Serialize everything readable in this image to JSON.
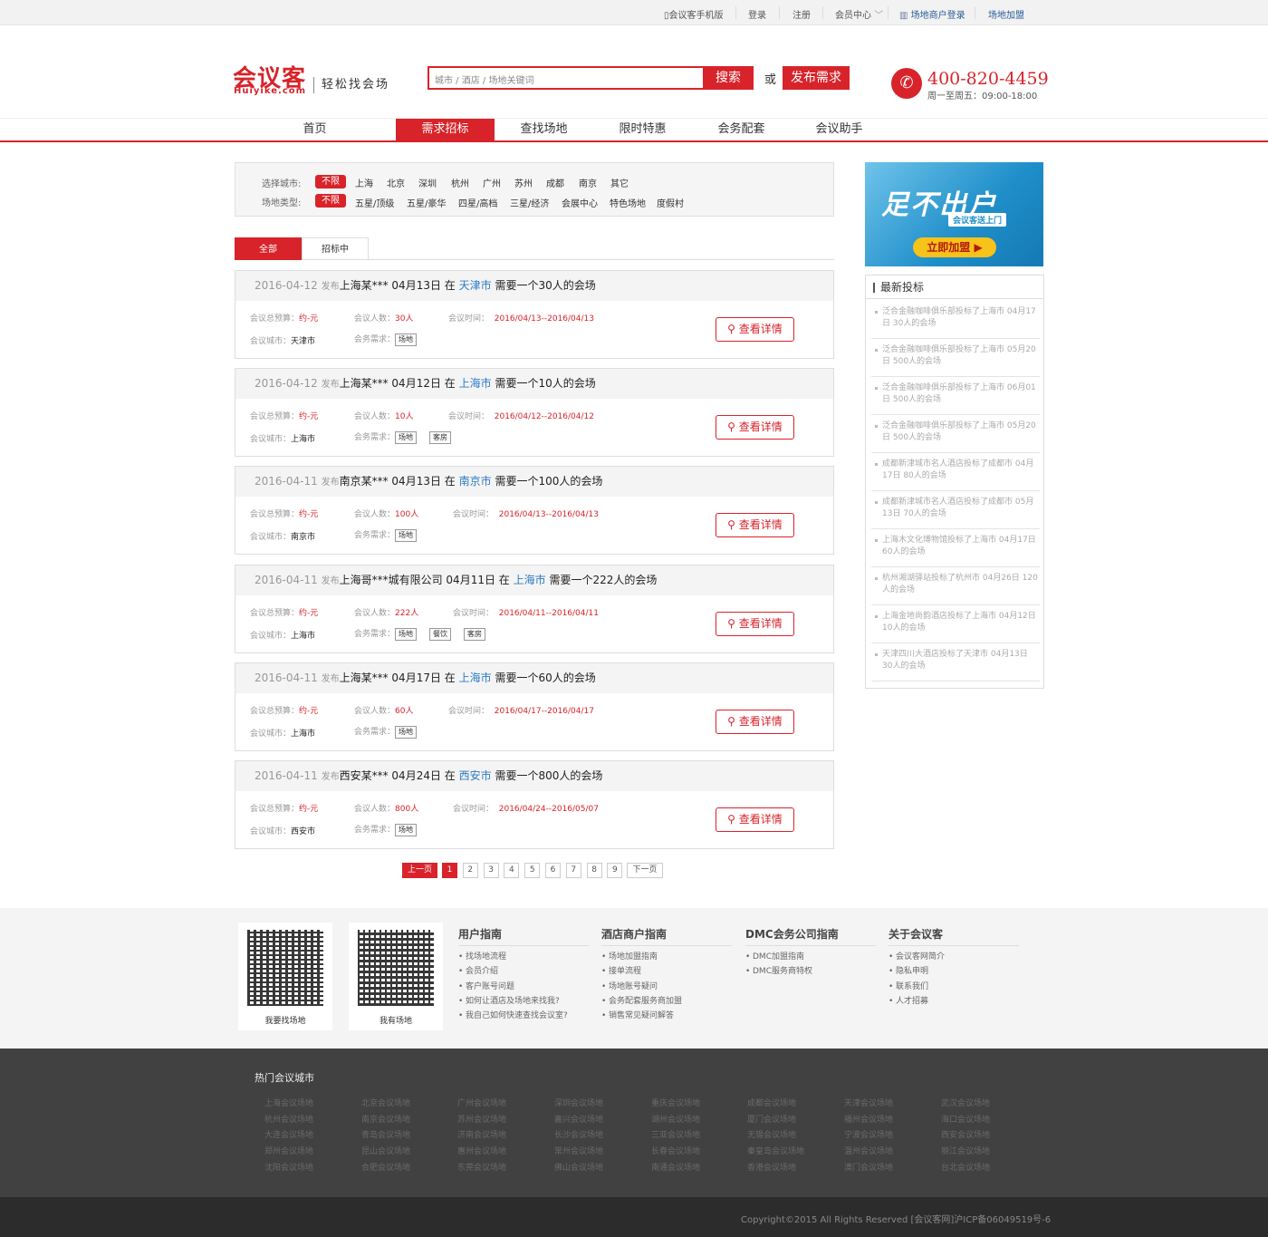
{
  "topbar": {
    "mobile": "会议客手机版",
    "login": "登录",
    "register": "注册",
    "member": "会员中心",
    "merchant_login": "场地商户登录",
    "join": "场地加盟"
  },
  "header": {
    "logo": "会议客",
    "logo_en": "Huiyike.com",
    "slogan": "轻松找会场",
    "search_placeholder": "城市 / 酒店 / 场地关键词",
    "search_btn": "搜索",
    "or": "或",
    "publish_btn": "发布需求",
    "phone": "400-820-4459",
    "hours": "周一至周五：09:00-18:00"
  },
  "nav": [
    "首页",
    "需求招标",
    "查找场地",
    "限时特惠",
    "会务配套",
    "会议助手"
  ],
  "filter": {
    "city_label": "选择城市:",
    "cities": [
      "不限",
      "上海",
      "北京",
      "深圳",
      "杭州",
      "广州",
      "苏州",
      "成都",
      "南京",
      "其它"
    ],
    "type_label": "场地类型:",
    "types": [
      "不限",
      "五星/顶级",
      "五星/豪华",
      "四星/高档",
      "三星/经济",
      "会展中心",
      "特色场地",
      "度假村"
    ]
  },
  "tabs": [
    "全部",
    "招标中"
  ],
  "labels": {
    "budget": "会议总预算：",
    "people": "会议人数：",
    "time": "会议时间：",
    "city": "会议城市：",
    "needs": "会务需求：",
    "published": "发布",
    "in": "在",
    "need": "需要一个",
    "venue": "的会场",
    "detail": "查看详情"
  },
  "cards": [
    {
      "date": "2016-04-12",
      "who": "上海某***",
      "day": "04月13日",
      "city": "天津市",
      "count": "30人",
      "budget": "约-元",
      "time": "2016/04/13--2016/04/13",
      "tags": [
        "场地"
      ]
    },
    {
      "date": "2016-04-12",
      "who": "上海某***",
      "day": "04月12日",
      "city": "上海市",
      "count": "10人",
      "budget": "约-元",
      "time": "2016/04/12--2016/04/12",
      "tags": [
        "场地",
        "客房"
      ]
    },
    {
      "date": "2016-04-11",
      "who": "南京某***",
      "day": "04月13日",
      "city": "南京市",
      "count": "100人",
      "budget": "约-元",
      "time": "2016/04/13--2016/04/13",
      "tags": [
        "场地"
      ]
    },
    {
      "date": "2016-04-11",
      "who": "上海哥***城有限公司",
      "day": "04月11日",
      "city": "上海市",
      "count": "222人",
      "budget": "约-元",
      "time": "2016/04/11--2016/04/11",
      "tags": [
        "场地",
        "餐饮",
        "客房"
      ]
    },
    {
      "date": "2016-04-11",
      "who": "上海某***",
      "day": "04月17日",
      "city": "上海市",
      "count": "60人",
      "budget": "约-元",
      "time": "2016/04/17--2016/04/17",
      "tags": [
        "场地"
      ]
    },
    {
      "date": "2016-04-11",
      "who": "西安某***",
      "day": "04月24日",
      "city": "西安市",
      "count": "800人",
      "budget": "约-元",
      "time": "2016/04/24--2016/05/07",
      "tags": [
        "场地"
      ]
    }
  ],
  "pager": {
    "prev": "上一页",
    "pages": [
      "1",
      "2",
      "3",
      "4",
      "5",
      "6",
      "7",
      "8",
      "9"
    ],
    "next": "下一页"
  },
  "ad": {
    "title": "足不出户",
    "sub": "会议客送上门",
    "btn": "立即加盟 ▶"
  },
  "latest": {
    "title": "最新投标",
    "items": [
      "泛合金融咖啡俱乐部投标了上海市 04月17日 30人的会场",
      "泛合金融咖啡俱乐部投标了上海市 05月20日 500人的会场",
      "泛合金融咖啡俱乐部投标了上海市 06月01日 500人的会场",
      "泛合金融咖啡俱乐部投标了上海市 05月20日 500人的会场",
      "成都新津城市名人酒店投标了成都市 04月17日 80人的会场",
      "成都新津城市名人酒店投标了成都市 05月13日 70人的会场",
      "上海木文化博物馆投标了上海市 04月17日 60人的会场",
      "杭州湘湖驿站投标了杭州市 04月26日 120人的会场",
      "上海金地尚韵酒店投标了上海市 04月12日 10人的会场",
      "天津四川大酒店投标了天津市 04月13日 30人的会场"
    ]
  },
  "footer": {
    "qr": [
      "我要找场地",
      "我有场地"
    ],
    "cols": [
      {
        "title": "用户指南",
        "items": [
          "找场地流程",
          "会员介绍",
          "客户账号问题",
          "如何让酒店及场地来找我?",
          "我自己如何快速查找会议室?"
        ]
      },
      {
        "title": "酒店商户指南",
        "items": [
          "场地加盟指南",
          "接单流程",
          "场地账号疑问",
          "会务配套服务商加盟",
          "销售常见疑问解答"
        ]
      },
      {
        "title": "DMC会务公司指南",
        "items": [
          "DMC加盟指南",
          "DMC服务商特权"
        ]
      },
      {
        "title": "关于会议客",
        "items": [
          "会议客网简介",
          "隐私申明",
          "联系我们",
          "人才招募"
        ]
      }
    ],
    "hot_title": "热门会议城市",
    "hot": [
      [
        "上海会议场地",
        "北京会议场地",
        "广州会议场地",
        "深圳会议场地",
        "重庆会议场地",
        "成都会议场地",
        "天津会议场地",
        "武汉会议场地"
      ],
      [
        "杭州会议场地",
        "南京会议场地",
        "苏州会议场地",
        "嘉兴会议场地",
        "湖州会议场地",
        "厦门会议场地",
        "福州会议场地",
        "海口会议场地"
      ],
      [
        "大连会议场地",
        "青岛会议场地",
        "济南会议场地",
        "长沙会议场地",
        "三亚会议场地",
        "无锡会议场地",
        "宁波会议场地",
        "西安会议场地"
      ],
      [
        "郑州会议场地",
        "昆山会议场地",
        "惠州会议场地",
        "常州会议场地",
        "长春会议场地",
        "秦皇岛会议场地",
        "温州会议场地",
        "丽江会议场地"
      ],
      [
        "沈阳会议场地",
        "合肥会议场地",
        "东莞会议场地",
        "佛山会议场地",
        "南通会议场地",
        "香港会议场地",
        "澳门会议场地",
        "台北会议场地"
      ]
    ],
    "copyright": "Copyright©2015 All Rights Reserved [会议客网]沪ICP备06049519号-6"
  }
}
